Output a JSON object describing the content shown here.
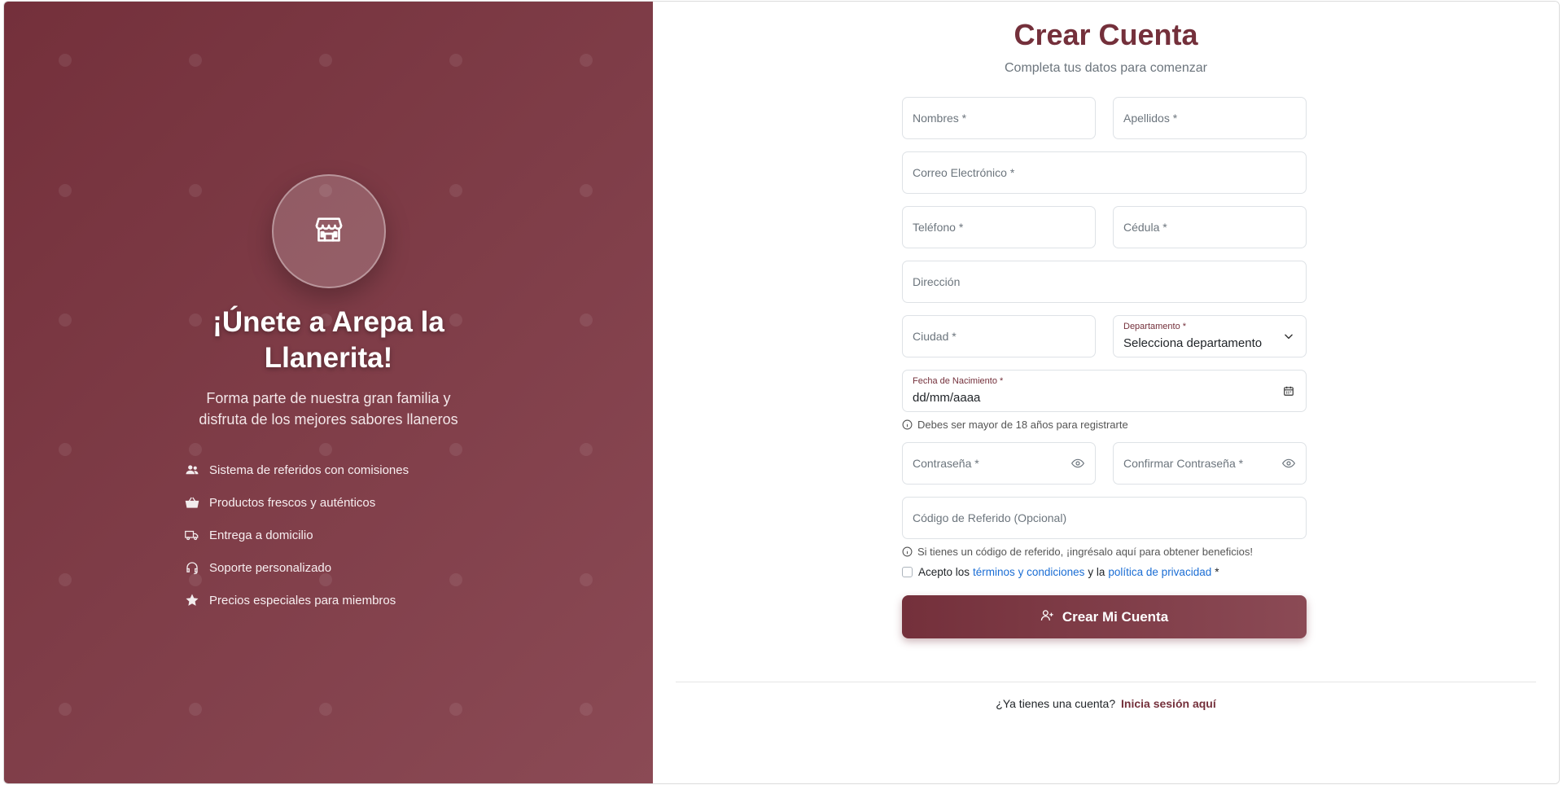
{
  "colors": {
    "brand": "#74303b",
    "brand_light": "#8b4a55",
    "link": "#1a6dd4"
  },
  "left": {
    "logo_icon": "store-icon",
    "heading": "¡Únete a Arepa la Llanerita!",
    "subheading": "Forma parte de nuestra gran familia y disfruta de los mejores sabores llaneros",
    "features": [
      {
        "icon": "users-icon",
        "label": "Sistema de referidos con comisiones"
      },
      {
        "icon": "basket-icon",
        "label": "Productos frescos y auténticos"
      },
      {
        "icon": "truck-icon",
        "label": "Entrega a domicilio"
      },
      {
        "icon": "headset-icon",
        "label": "Soporte personalizado"
      },
      {
        "icon": "star-icon",
        "label": "Precios especiales para miembros"
      }
    ]
  },
  "form": {
    "title": "Crear Cuenta",
    "subtitle": "Completa tus datos para comenzar",
    "nombres": "Nombres *",
    "apellidos": "Apellidos *",
    "correo": "Correo Electrónico *",
    "telefono": "Teléfono *",
    "cedula": "Cédula *",
    "direccion": "Dirección",
    "ciudad": "Ciudad *",
    "departamento": {
      "label": "Departamento *",
      "value": "Selecciona departamento"
    },
    "fecha": {
      "label": "Fecha de Nacimiento *",
      "value": "dd/mm/aaaa"
    },
    "fecha_help": "Debes ser mayor de 18 años para registrarte",
    "password": "Contraseña *",
    "confirm_password": "Confirmar Contraseña *",
    "referral": "Código de Referido (Opcional)",
    "referral_help": "Si tienes un código de referido, ¡ingrésalo aquí para obtener beneficios!",
    "terms": {
      "prefix": "Acepto los",
      "terms_link": "términos y condiciones",
      "middle": "y la",
      "privacy_link": "política de privacidad",
      "suffix": "*"
    },
    "submit": "Crear Mi Cuenta",
    "login_prompt": "¿Ya tienes una cuenta?",
    "login_link": "Inicia sesión aquí"
  }
}
